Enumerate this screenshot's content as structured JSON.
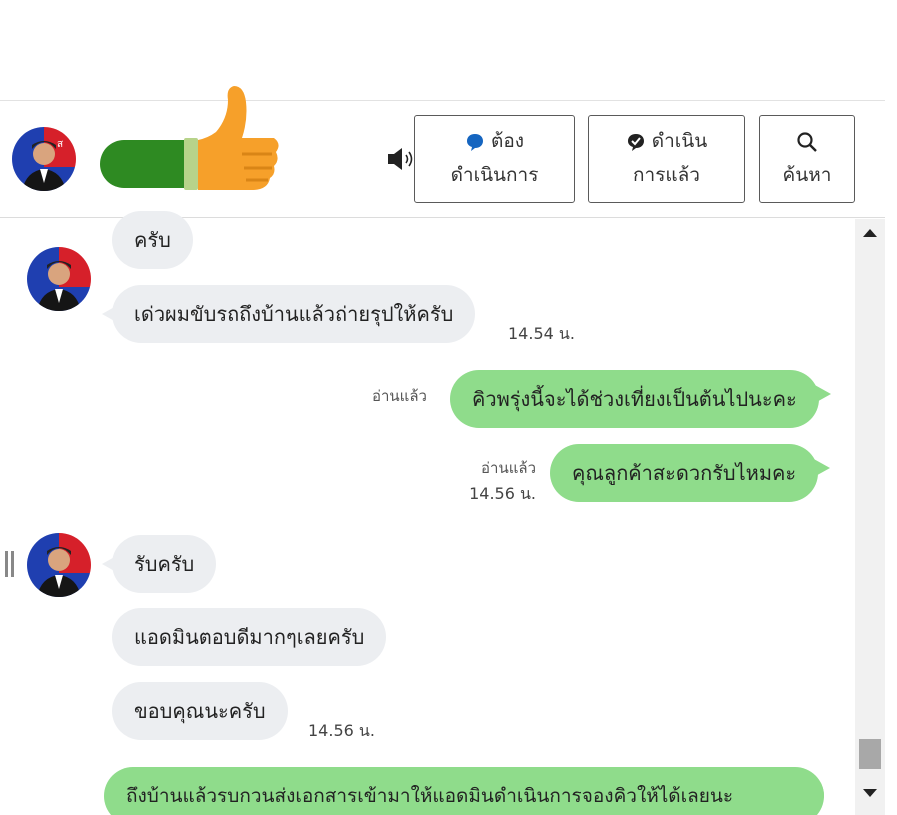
{
  "header": {
    "buttons": {
      "todo_line1": "ต้อง",
      "todo_line2": "ดำเนินการ",
      "done_line1": "ดำเนิน",
      "done_line2": "การแล้ว",
      "search_label": "ค้นหา"
    },
    "icons": {
      "speaker": "speaker-icon",
      "todo": "chat-bubble-icon",
      "done": "check-bubble-icon",
      "search": "search-icon"
    }
  },
  "messages": {
    "m1": "ครับ",
    "m2": "เด่วผมขับรถถึงบ้านแล้วถ่ายรุปให้ครับ",
    "m2_time": "14.54 น.",
    "m3": "คิวพรุ่งนี้จะได้ช่วงเที่ยงเป็นต้นไปนะคะ",
    "m3_read": "อ่านแล้ว",
    "m4": "คุณลูกค้าสะดวกรับไหมคะ",
    "m4_read": "อ่านแล้ว",
    "m4_time": "14.56 น.",
    "m5": "รับครับ",
    "m6": "แอดมินตอบดีมากๆเลยครับ",
    "m7": "ขอบคุณนะครับ",
    "m7_time": "14.56 น.",
    "m8": "ถึงบ้านแล้วรบกวนส่งเอกสารเข้ามาให้แอดมินดำเนินการจองคิวให้ได้เลยนะ"
  },
  "colors": {
    "outgoing_bubble": "#8fdc8b",
    "incoming_bubble": "#eceef1",
    "name_redaction": "#2e8a22"
  }
}
